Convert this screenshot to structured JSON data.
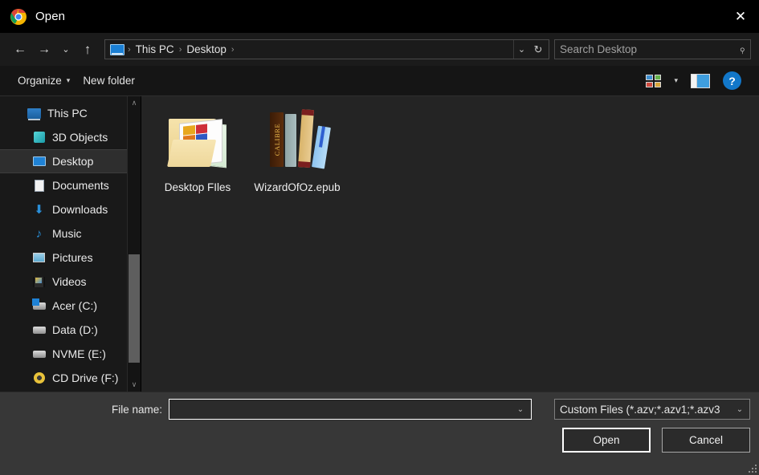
{
  "window": {
    "title": "Open",
    "app_icon": "chrome-icon",
    "close_label": "✕"
  },
  "nav": {
    "back_label": "←",
    "forward_label": "→",
    "recent_label": "⌄",
    "up_label": "↑",
    "breadcrumb": {
      "root_icon": "this-pc-monitor-icon",
      "items": [
        "This PC",
        "Desktop"
      ],
      "separator": "›",
      "trailing_separator": "›"
    },
    "address_dropdown": "⌄",
    "refresh_label": "↻"
  },
  "search": {
    "placeholder": "Search Desktop",
    "value": "",
    "icon": "search-icon",
    "icon_glyph": "⌕"
  },
  "toolbar": {
    "organize_label": "Organize",
    "organize_caret": "▾",
    "new_folder_label": "New folder",
    "view_icon": "view-options-icon",
    "view_caret": "▾",
    "preview_pane_icon": "preview-pane-icon",
    "help_label": "?"
  },
  "sidebar": {
    "scroll_up": "∧",
    "scroll_down": "∨",
    "items": [
      {
        "label": "This PC",
        "icon": "this-pc-icon",
        "selected": false
      },
      {
        "label": "3D Objects",
        "icon": "3d-objects-icon",
        "selected": false
      },
      {
        "label": "Desktop",
        "icon": "desktop-icon",
        "selected": true
      },
      {
        "label": "Documents",
        "icon": "documents-icon",
        "selected": false
      },
      {
        "label": "Downloads",
        "icon": "downloads-icon",
        "selected": false
      },
      {
        "label": "Music",
        "icon": "music-icon",
        "selected": false
      },
      {
        "label": "Pictures",
        "icon": "pictures-icon",
        "selected": false
      },
      {
        "label": "Videos",
        "icon": "videos-icon",
        "selected": false
      },
      {
        "label": "Acer (C:)",
        "icon": "hard-drive-icon",
        "selected": false
      },
      {
        "label": "Data (D:)",
        "icon": "hard-drive-icon",
        "selected": false
      },
      {
        "label": "NVME (E:)",
        "icon": "hard-drive-icon",
        "selected": false
      },
      {
        "label": "CD Drive (F:)",
        "icon": "cd-drive-icon",
        "selected": false
      }
    ]
  },
  "files": [
    {
      "name": "Desktop FIles",
      "icon": "folder-icon",
      "type": "folder"
    },
    {
      "name": "WizardOfOz.epub",
      "icon": "calibre-ebook-icon",
      "type": "file"
    }
  ],
  "footer": {
    "filename_label": "File name:",
    "filename_value": "",
    "filename_caret": "⌄",
    "filetype_value": "Custom Files (*.azv;*.azv1;*.azv3",
    "filetype_caret": "⌄",
    "open_label": "Open",
    "cancel_label": "Cancel"
  },
  "colors": {
    "accent_blue": "#1277c9",
    "title_bar_bg": "#000000",
    "dialog_bg": "#1b1b1b",
    "sidebar_bg": "#191919",
    "file_area_bg": "#242424",
    "footer_bg": "#373737",
    "selection_bg": "#2e2e2e"
  }
}
